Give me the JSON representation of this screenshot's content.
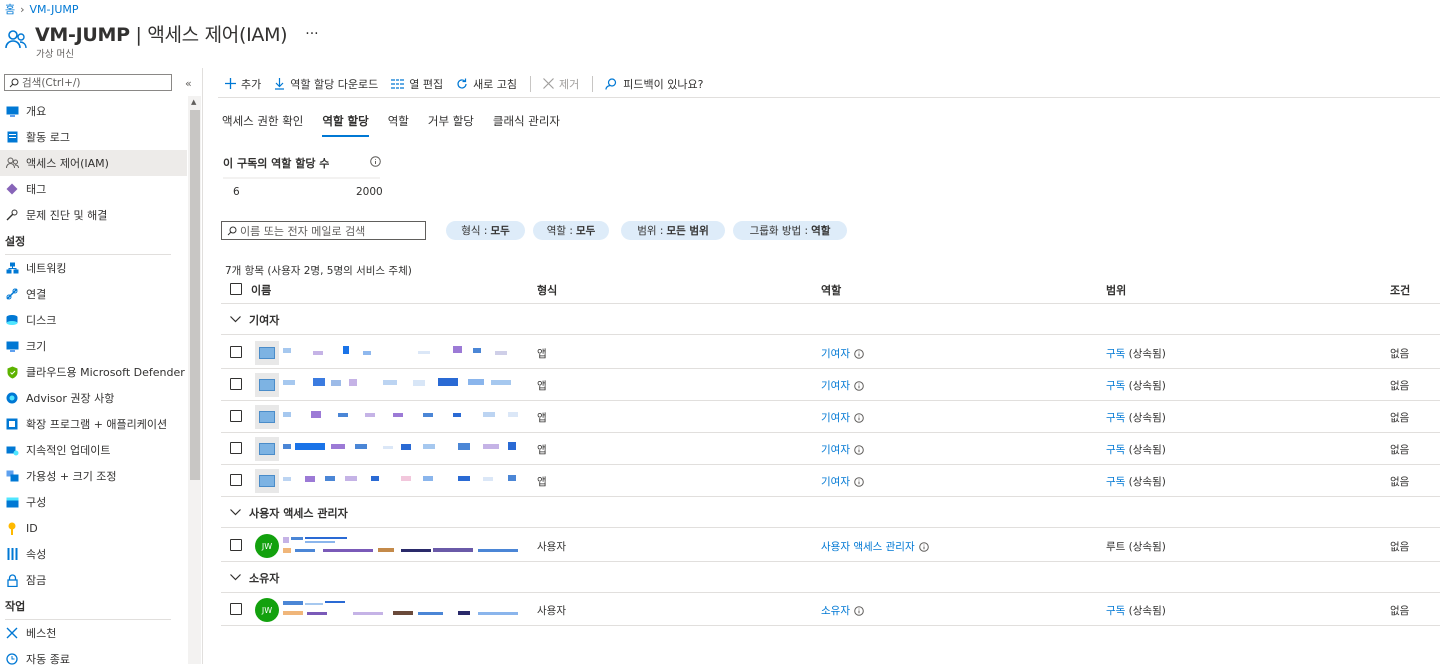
{
  "breadcrumb": {
    "home": "홈",
    "current": "VM-JUMP"
  },
  "header": {
    "title_main": "VM-JUMP",
    "title_rest": " | 액세스 제어(IAM)",
    "subtitle": "가상 머신",
    "more": "···"
  },
  "sidebar": {
    "search_placeholder": "검색(Ctrl+/)",
    "collapse": "«",
    "items_top": [
      {
        "label": "개요",
        "icon": "monitor-icon"
      },
      {
        "label": "활동 로그",
        "icon": "activity-log-icon"
      },
      {
        "label": "액세스 제어(IAM)",
        "icon": "people-icon",
        "active": true
      },
      {
        "label": "태그",
        "icon": "tag-icon"
      },
      {
        "label": "문제 진단 및 해결",
        "icon": "wrench-icon"
      }
    ],
    "section_settings": "설정",
    "items_settings": [
      {
        "label": "네트워킹",
        "icon": "network-icon"
      },
      {
        "label": "연결",
        "icon": "connect-icon"
      },
      {
        "label": "디스크",
        "icon": "disk-icon"
      },
      {
        "label": "크기",
        "icon": "size-icon"
      },
      {
        "label": "클라우드용 Microsoft Defender",
        "icon": "shield-icon"
      },
      {
        "label": "Advisor 권장 사항",
        "icon": "advisor-icon"
      },
      {
        "label": "확장 프로그램 + 애플리케이션",
        "icon": "extension-icon"
      },
      {
        "label": "지속적인 업데이트",
        "icon": "update-icon"
      },
      {
        "label": "가용성 + 크기 조정",
        "icon": "availability-icon"
      },
      {
        "label": "구성",
        "icon": "config-icon"
      },
      {
        "label": "ID",
        "icon": "key-icon"
      },
      {
        "label": "속성",
        "icon": "properties-icon"
      },
      {
        "label": "잠금",
        "icon": "lock-icon"
      }
    ],
    "section_ops": "작업",
    "items_ops": [
      {
        "label": "베스천",
        "icon": "bastion-icon"
      },
      {
        "label": "자동 종료",
        "icon": "clock-icon"
      }
    ]
  },
  "toolbar": {
    "add": "추가",
    "download": "역할 할당 다운로드",
    "edit_columns": "열 편집",
    "refresh": "새로 고침",
    "remove": "제거",
    "feedback": "피드백이 있나요?"
  },
  "tabs": [
    "액세스 권한 확인",
    "역할 할당",
    "역할",
    "거부 할당",
    "클래식 관리자"
  ],
  "count": {
    "title": "이 구독의 역할 할당 수",
    "value": "6",
    "max": "2000"
  },
  "filters": {
    "search_placeholder": "이름 또는 전자 메일로 검색",
    "type_label": "형식 :",
    "type_value": "모두",
    "role_label": "역할 :",
    "role_value": "모두",
    "scope_label": "범위 :",
    "scope_value": "모든 범위",
    "group_label": "그룹화 방법 :",
    "group_value": "역할"
  },
  "table": {
    "items_summary": "7개 항목 (사용자 2명, 5명의 서비스 주체)",
    "columns": [
      "이름",
      "형식",
      "역할",
      "범위",
      "조건"
    ],
    "groups": [
      {
        "label": "기여자",
        "rows": [
          {
            "type": "앱",
            "role": "기여자",
            "scope_link": "구독",
            "scope_rest": " (상속됨)",
            "condition": "없음"
          },
          {
            "type": "앱",
            "role": "기여자",
            "scope_link": "구독",
            "scope_rest": " (상속됨)",
            "condition": "없음"
          },
          {
            "type": "앱",
            "role": "기여자",
            "scope_link": "구독",
            "scope_rest": " (상속됨)",
            "condition": "없음"
          },
          {
            "type": "앱",
            "role": "기여자",
            "scope_link": "구독",
            "scope_rest": " (상속됨)",
            "condition": "없음"
          },
          {
            "type": "앱",
            "role": "기여자",
            "scope_link": "구독",
            "scope_rest": " (상속됨)",
            "condition": "없음"
          }
        ]
      },
      {
        "label": "사용자 액세스 관리자",
        "rows": [
          {
            "type": "사용자",
            "role": "사용자 액세스 관리자",
            "avatar": "JW",
            "scope_link": "",
            "scope_rest": "루트 (상속됨)",
            "condition": "없음"
          }
        ]
      },
      {
        "label": "소유자",
        "rows": [
          {
            "type": "사용자",
            "role": "소유자",
            "avatar": "JW",
            "scope_link": "구독",
            "scope_rest": " (상속됨)",
            "condition": "없음"
          }
        ]
      }
    ]
  },
  "colors": {
    "accent": "#0078d4",
    "pill": "#deecf9",
    "avatar_green": "#13a10e"
  }
}
